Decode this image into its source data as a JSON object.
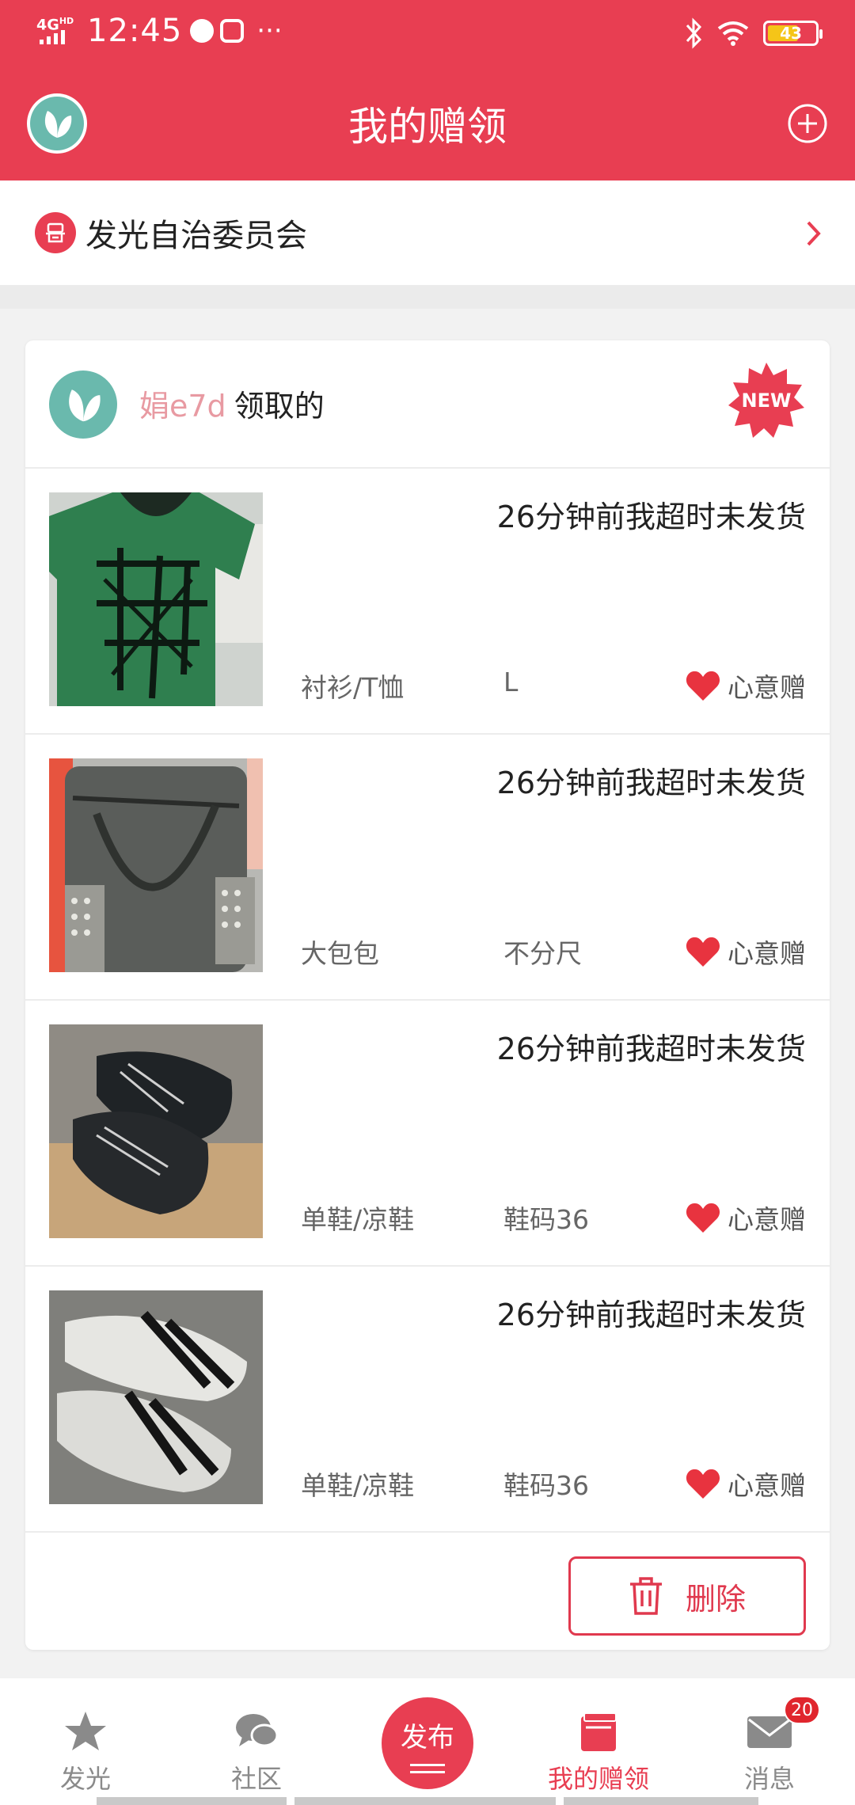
{
  "status_bar": {
    "network": "4G",
    "network_sup": "HD",
    "time": "12:45",
    "overflow": "···",
    "battery": "43"
  },
  "header": {
    "title": "我的赠领",
    "logo_icon": "leaf-logo-icon",
    "add_icon": "plus-circle-icon"
  },
  "org": {
    "name": "发光自治委员会",
    "icon": "org-building-icon",
    "chevron_icon": "chevron-right-icon"
  },
  "card": {
    "receiver_name": "娟e7d",
    "receiver_suffix": "领取的",
    "badge": "NEW",
    "items": [
      {
        "status": "26分钟前我超时未发货",
        "category": "衬衫/T恤",
        "size": "L",
        "gift_label": "心意赠",
        "thumb": "green-tshirt"
      },
      {
        "status": "26分钟前我超时未发货",
        "category": "大包包",
        "size": "不分尺",
        "gift_label": "心意赠",
        "thumb": "gray-leather-bag"
      },
      {
        "status": "26分钟前我超时未发货",
        "category": "单鞋/凉鞋",
        "size": "鞋码36",
        "gift_label": "心意赠",
        "thumb": "black-shoes"
      },
      {
        "status": "26分钟前我超时未发货",
        "category": "单鞋/凉鞋",
        "size": "鞋码36",
        "gift_label": "心意赠",
        "thumb": "white-sneakers"
      }
    ],
    "delete_label": "删除"
  },
  "nav": {
    "items": [
      {
        "label": "发光",
        "icon": "star-icon"
      },
      {
        "label": "社区",
        "icon": "chat-bubbles-icon"
      },
      {
        "label": "发布",
        "icon": "publish-icon"
      },
      {
        "label": "我的赠领",
        "icon": "gift-box-icon"
      },
      {
        "label": "消息",
        "icon": "envelope-icon",
        "badge": "20"
      }
    ]
  },
  "colors": {
    "brand_red": "#e83e52",
    "teal": "#6ab9ad",
    "badge_red": "#e0262d"
  }
}
